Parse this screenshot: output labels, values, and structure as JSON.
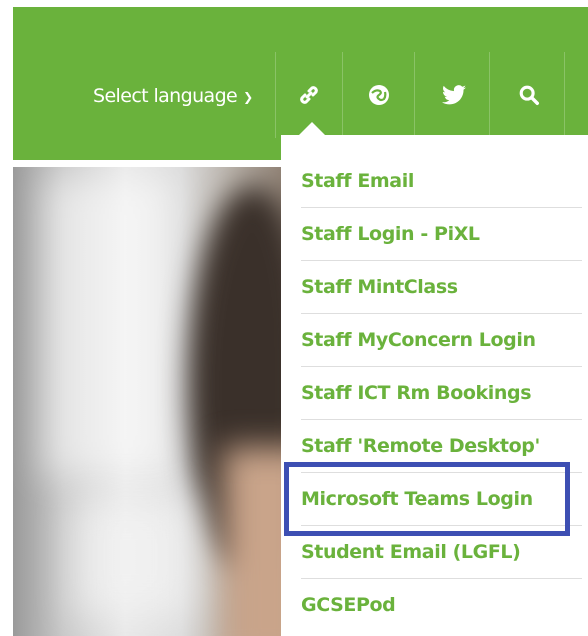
{
  "header": {
    "language_label": "Select language",
    "icons": [
      "link-icon",
      "globe-icon",
      "twitter-icon",
      "search-icon"
    ]
  },
  "dropdown": {
    "items": [
      "Staff Email",
      "Staff Login - PiXL",
      "Staff MintClass",
      "Staff MyConcern Login",
      "Staff ICT Rm Bookings",
      "Staff 'Remote Desktop'",
      "Microsoft Teams Login",
      "Student Email (LGFL)",
      "GCSEPod"
    ],
    "highlighted_item": "Microsoft Teams Login"
  },
  "colors": {
    "brand_green": "#6ab23c",
    "highlight_border": "#3d4fb3"
  }
}
